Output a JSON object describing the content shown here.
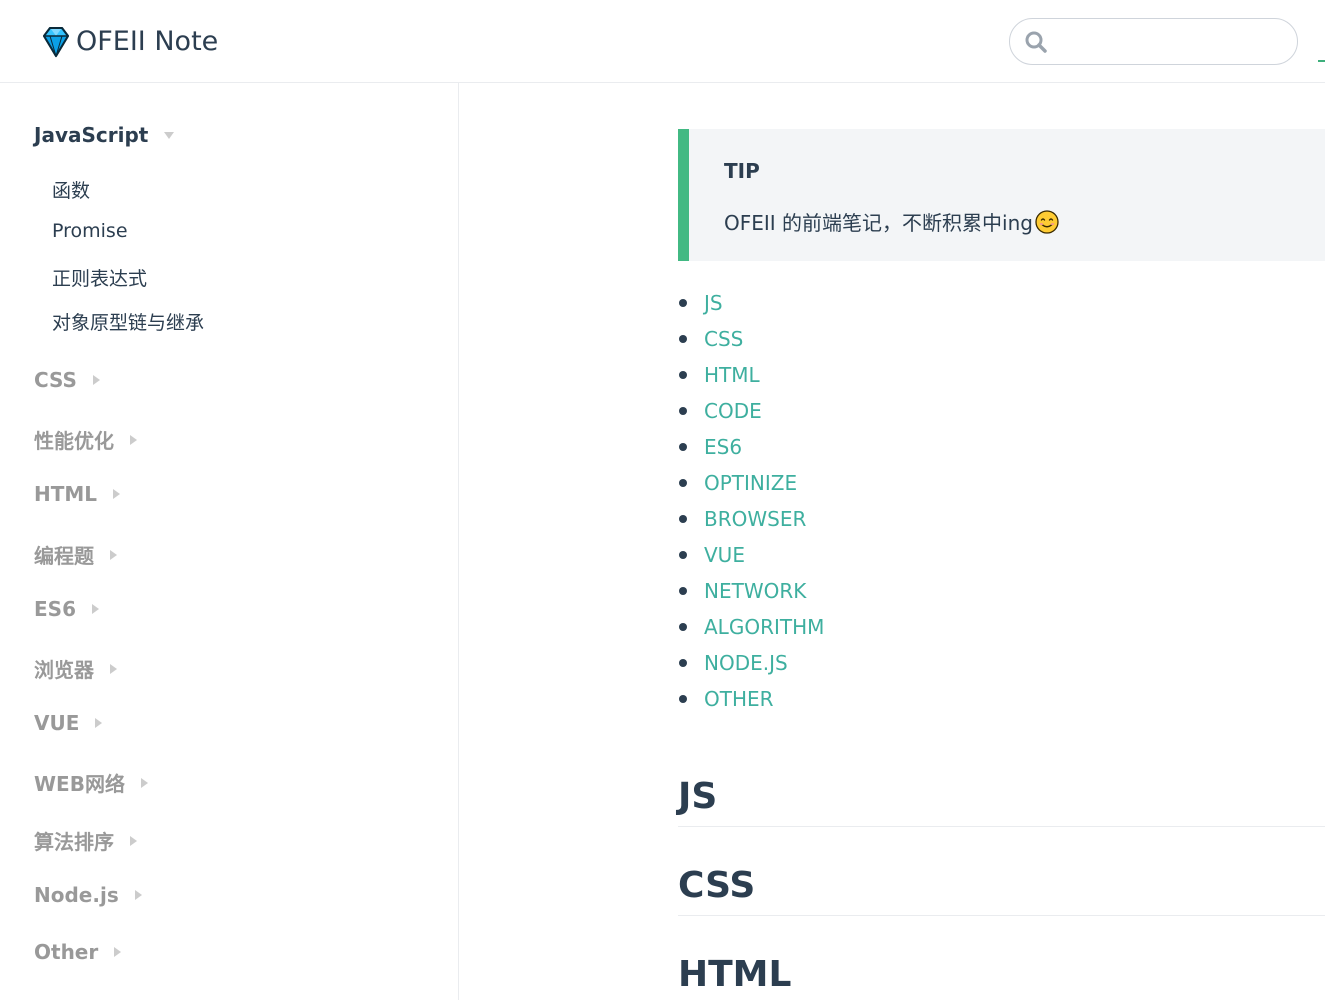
{
  "header": {
    "site_name": "OFEII Note",
    "logo_icon": "diamond-icon",
    "search": {
      "placeholder": "",
      "value": ""
    }
  },
  "sidebar": {
    "groups": [
      {
        "label": "JavaScript",
        "expanded": true,
        "children": [
          "函数",
          "Promise",
          "正则表达式",
          "对象原型链与继承"
        ]
      },
      {
        "label": "CSS",
        "expanded": false
      },
      {
        "label": "性能优化",
        "expanded": false
      },
      {
        "label": "HTML",
        "expanded": false
      },
      {
        "label": "编程题",
        "expanded": false
      },
      {
        "label": "ES6",
        "expanded": false
      },
      {
        "label": "浏览器",
        "expanded": false
      },
      {
        "label": "VUE",
        "expanded": false
      },
      {
        "label": "WEB网络",
        "expanded": false
      },
      {
        "label": "算法排序",
        "expanded": false
      },
      {
        "label": "Node.js",
        "expanded": false
      },
      {
        "label": "Other",
        "expanded": false
      }
    ]
  },
  "content": {
    "tip": {
      "title": "TIP",
      "text": "OFEII 的前端笔记，不断积累中ing",
      "emoji": "smiling-face-icon"
    },
    "toc": [
      "JS",
      "CSS",
      "HTML",
      "CODE",
      "ES6",
      "OPTINIZE",
      "BROWSER",
      "VUE",
      "NETWORK",
      "ALGORITHM",
      "NODE.JS",
      "OTHER"
    ],
    "headings": [
      "JS",
      "CSS",
      "HTML"
    ]
  },
  "colors": {
    "accent": "#3eaf7c",
    "link": "#3eaf9f",
    "text": "#2c3e50",
    "muted": "#999999",
    "tip_bg": "#f3f5f7",
    "tip_border": "#42b983"
  }
}
